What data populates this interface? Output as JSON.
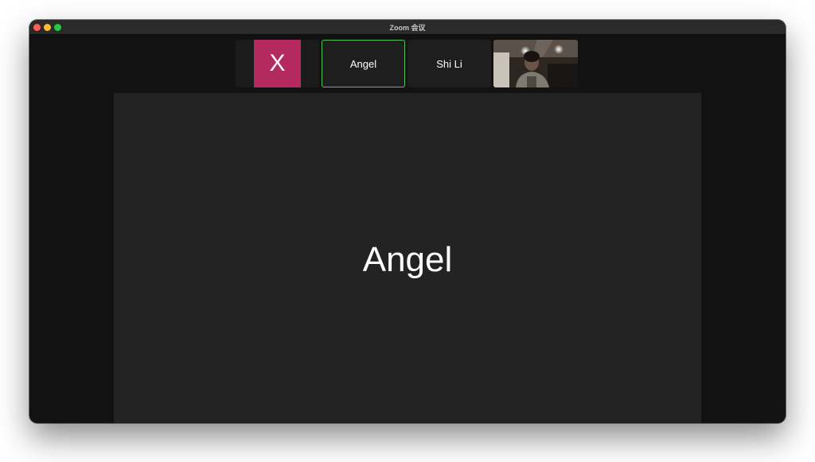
{
  "window": {
    "title": "Zoom 会议"
  },
  "participants": [
    {
      "id": "x",
      "avatar_letter": "X",
      "avatar_color": "#b52a5e",
      "has_video": false
    },
    {
      "id": "angel",
      "name": "Angel",
      "active_speaker": true,
      "highlight_color": "#4ec553"
    },
    {
      "id": "shi-li",
      "name": "Shi Li"
    },
    {
      "id": "self",
      "has_video": true
    }
  ],
  "stage": {
    "speaker_name": "Angel"
  }
}
